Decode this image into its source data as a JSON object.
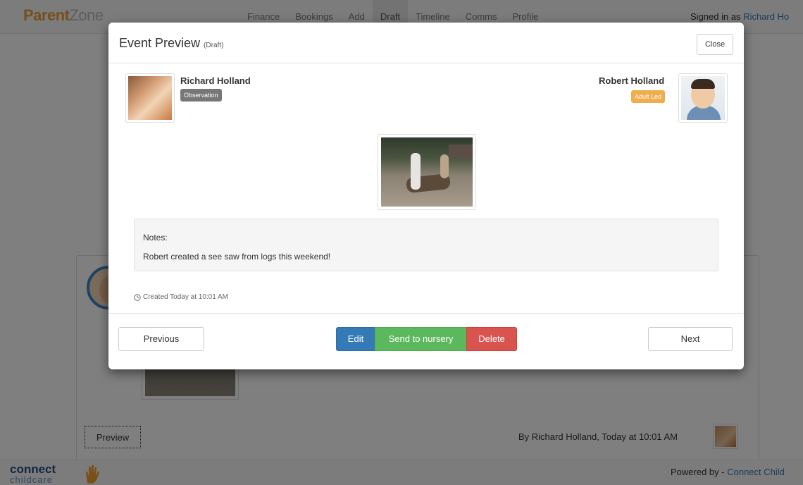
{
  "navbar": {
    "brand_part1": "Parent",
    "brand_part2": "Zone",
    "links": [
      "Finance",
      "Bookings",
      "Add",
      "Draft",
      "Timeline",
      "Comms",
      "Profile"
    ],
    "signed_in_prefix": "Signed in as",
    "signed_in_user": "Richard Ho"
  },
  "modal": {
    "title": "Event Preview",
    "title_suffix": "(Draft)",
    "close_label": "Close",
    "author_name": "Richard Holland",
    "author_label": "Observation",
    "child_name": "Robert Holland",
    "child_label": "Adult Led",
    "notes_label": "Notes:",
    "notes_text": "Robert created a see saw from logs this weekend!",
    "created_text": "Created Today at 10:01 AM",
    "buttons": {
      "previous": "Previous",
      "edit": "Edit",
      "send": "Send to nursery",
      "delete": "Delete",
      "next": "Next"
    }
  },
  "background": {
    "preview_label": "Preview",
    "byline": "By Richard Holland, Today at 10:01 AM"
  },
  "footer": {
    "logo_top": "connect",
    "logo_bottom": "childcare",
    "powered_prefix": "Powered by -",
    "powered_link": "Connect Child"
  },
  "colors": {
    "brand_orange": "#e8a13a",
    "primary": "#337ab7",
    "success": "#5cb85c",
    "danger": "#d9534f",
    "warning": "#f0ad4e",
    "default_label": "#777777"
  }
}
